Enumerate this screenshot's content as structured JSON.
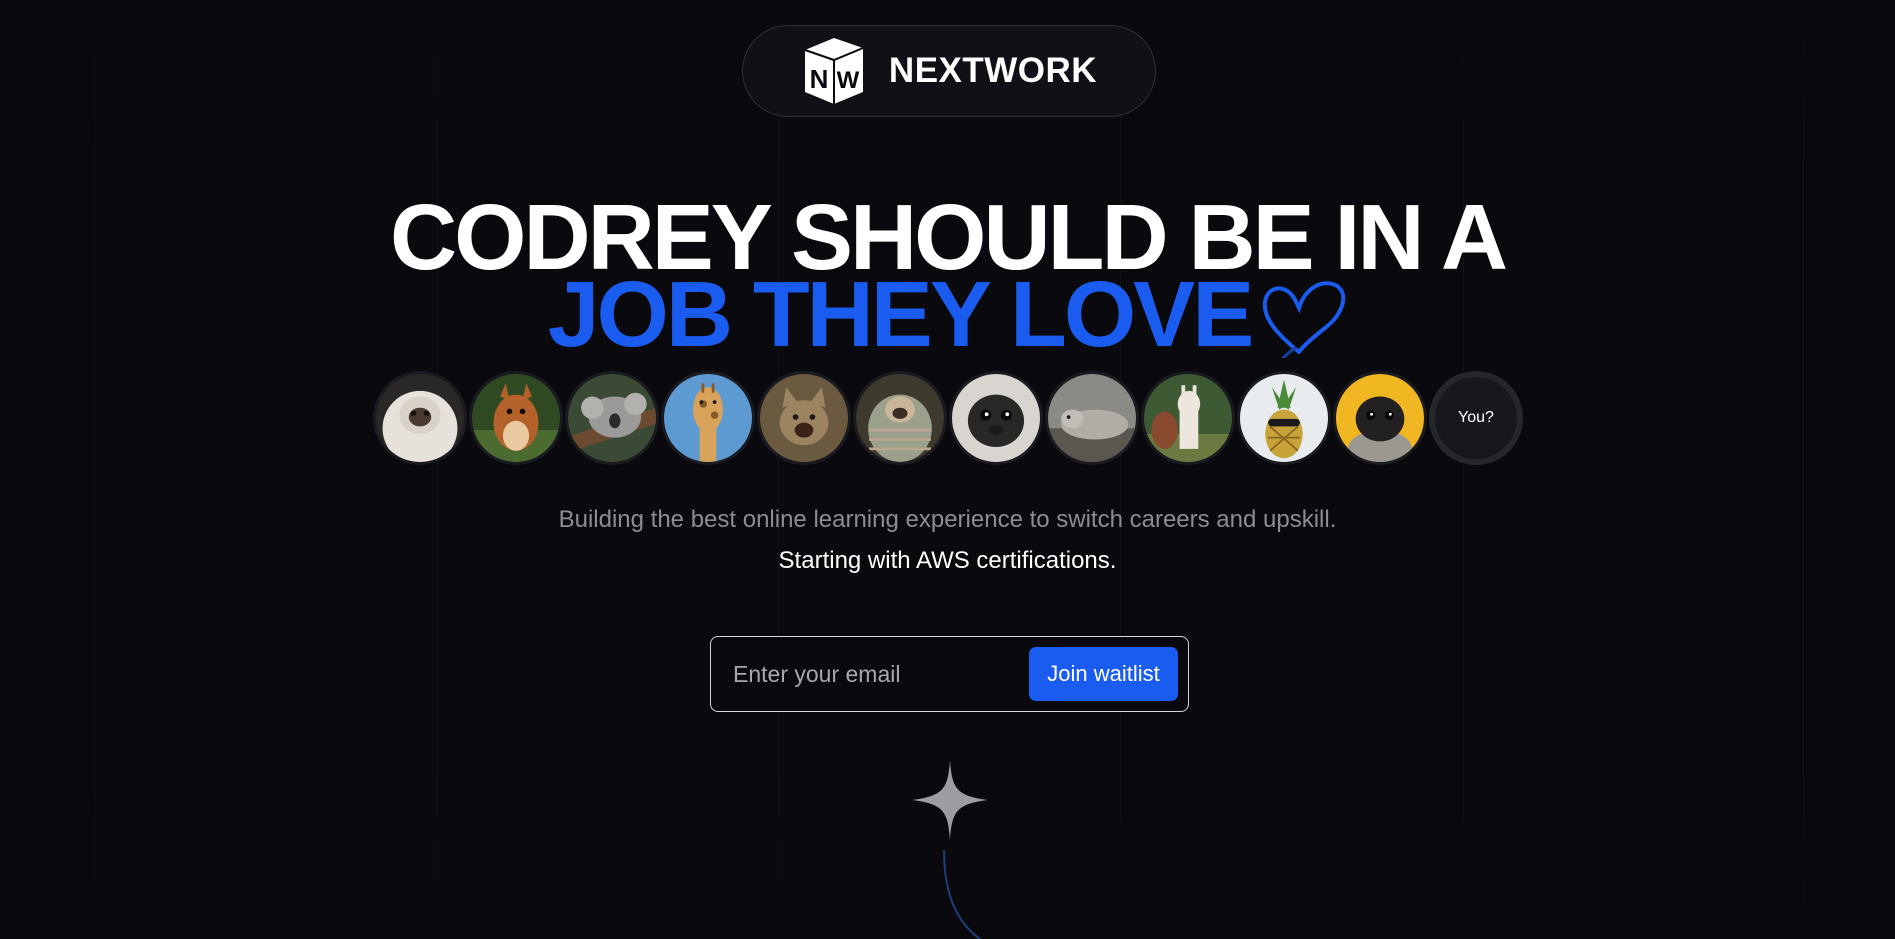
{
  "brand": {
    "name": "NEXTWORK",
    "logo_letters": [
      "N",
      "W"
    ]
  },
  "headline": {
    "line1": "CODREY SHOULD BE IN A",
    "line2": "JOB THEY LOVE"
  },
  "avatars": [
    {
      "label": "fluffy-monkey-avatar"
    },
    {
      "label": "squirrel-avatar"
    },
    {
      "label": "koala-avatar"
    },
    {
      "label": "giraffe-avatar"
    },
    {
      "label": "cat-avatar"
    },
    {
      "label": "pug-blanket-avatar"
    },
    {
      "label": "pug-face-avatar"
    },
    {
      "label": "seal-avatar"
    },
    {
      "label": "llama-avatar"
    },
    {
      "label": "pineapple-avatar"
    },
    {
      "label": "pug-yellow-avatar"
    }
  ],
  "you_label": "You?",
  "subtitle": {
    "line1": "Building the best online learning experience to switch careers and upskill.",
    "line2": "Starting with AWS certifications."
  },
  "waitlist": {
    "placeholder": "Enter your email",
    "button_label": "Join waitlist"
  },
  "colors": {
    "accent": "#1a5cf0",
    "background": "#0a0a0e"
  }
}
